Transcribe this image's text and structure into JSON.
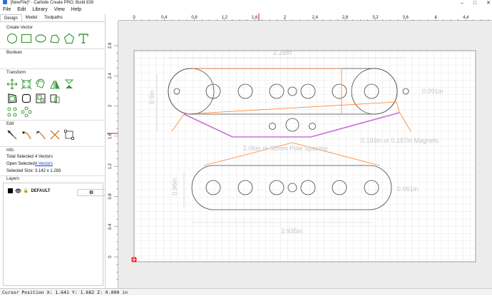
{
  "app": {
    "title": "[NewFile]* - Carbide Create PRO, Build 839"
  },
  "window_controls": {
    "minimize": "–",
    "maximize": "□",
    "close": "✕"
  },
  "menu": [
    "File",
    "Edit",
    "Library",
    "View",
    "Help"
  ],
  "tabs": [
    "Design",
    "Model",
    "Toolpaths"
  ],
  "sections": {
    "create_vector": "Create Vector",
    "boolean": "Boolean",
    "transform": "Transform",
    "edit": "Edit",
    "info": "Info",
    "layers": "Layers"
  },
  "info": {
    "total_selected_label": "Total Selected:",
    "total_selected_value": "4 Vectors",
    "open_selected_label": "Open Selected:",
    "open_selected_value": "4 Vectors",
    "selected_size_label": "Selected Size:",
    "selected_size_value": "3.142 x 1.283"
  },
  "layers": [
    {
      "name": "DEFAULT",
      "color": "#000000",
      "gear": "⚙"
    }
  ],
  "ruler": {
    "top_labels": [
      "0",
      "0.4",
      "0.8",
      "1.2",
      "1.6",
      "2",
      "2.4",
      "2.8",
      "3.2",
      "3.6",
      "4",
      "4.4"
    ],
    "left_labels": [
      "2.8",
      "2.4",
      "2",
      "1.6",
      "1.2",
      "0.8",
      "0.4",
      "0"
    ]
  },
  "dimensions": {
    "top_width": "3.28in",
    "left_height": "0.9in",
    "right_radius": "0.091in",
    "pole_spacing": "2.06in or 52mm Pole Spacing",
    "magnets": "0.193in or 0.187in Magnets",
    "lower_height": "0.96in",
    "lower_radius": "0.061in",
    "bottom_width": "2.935in"
  },
  "status": {
    "cursor": "Cursor Position X: 1.641 Y: 1.682 Z: 0.000 in"
  },
  "colors": {
    "accent": "#ff7f27",
    "selection": "#c870d8",
    "tool_green": "#3c9a3c",
    "origin": "#e01010"
  }
}
